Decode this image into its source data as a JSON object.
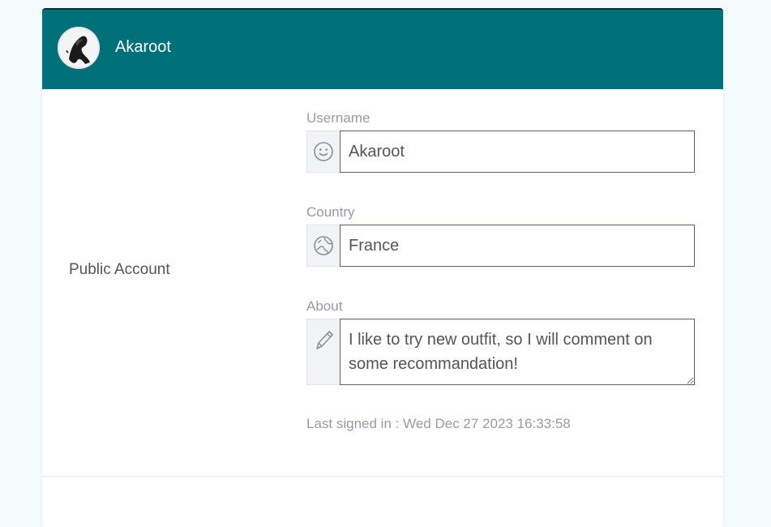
{
  "header": {
    "name": "Akaroot"
  },
  "section": {
    "label": "Public Account"
  },
  "fields": {
    "username": {
      "label": "Username",
      "value": "Akaroot",
      "icon": "smiley-icon"
    },
    "country": {
      "label": "Country",
      "value": "France",
      "icon": "globe-icon"
    },
    "about": {
      "label": "About",
      "value": "I like to try new outfit, so I will comment on some recommandation!",
      "icon": "pencil-icon"
    }
  },
  "last_signed": "Last signed in : Wed Dec 27 2023 16:33:58",
  "colors": {
    "header_bg": "#00707a",
    "page_bg": "#f3fbfc",
    "label": "#9a9aa6"
  }
}
